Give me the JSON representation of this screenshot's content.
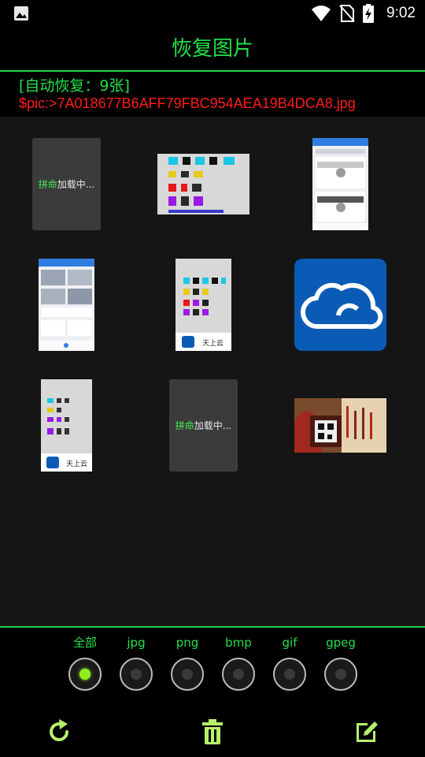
{
  "status_bar": {
    "time": "9:02",
    "icons": [
      "gallery-icon",
      "wifi-icon",
      "no-sim-icon",
      "battery-charging-icon"
    ]
  },
  "header": {
    "title": "恢复图片"
  },
  "info": {
    "recovered_label": "[自动恢复：9张]",
    "file_label": "$pic:>7A018677B6AFF79FBC954AEA19B4DCA8.jpg"
  },
  "grid": {
    "tiles": [
      {
        "kind": "loading",
        "loading_green": "拼命",
        "loading_white": "加载中..."
      },
      {
        "kind": "image",
        "desc": "colored-glyph-thumbnail"
      },
      {
        "kind": "image",
        "desc": "phone-screenshot-thumbnail"
      },
      {
        "kind": "image",
        "desc": "phone-screenshot-thumbnail"
      },
      {
        "kind": "image",
        "desc": "cloud-app-thumbnail",
        "caption": "天上云"
      },
      {
        "kind": "image",
        "desc": "cloud-logo",
        "color": "#0a5bb5"
      },
      {
        "kind": "image",
        "desc": "cloud-app-thumbnail",
        "caption": "天上云"
      },
      {
        "kind": "loading",
        "loading_green": "拼命",
        "loading_white": "加载中..."
      },
      {
        "kind": "image",
        "desc": "game-banner-thumbnail"
      }
    ]
  },
  "filters": {
    "options": [
      {
        "label": "全部",
        "selected": true
      },
      {
        "label": "jpg",
        "selected": false
      },
      {
        "label": "png",
        "selected": false
      },
      {
        "label": "bmp",
        "selected": false
      },
      {
        "label": "gif",
        "selected": false
      },
      {
        "label": "gpeg",
        "selected": false
      }
    ]
  },
  "toolbar": {
    "buttons": [
      "refresh-icon",
      "trash-icon",
      "edit-icon"
    ]
  },
  "colors": {
    "accent_green": "#22e04a",
    "error_red": "#ff1a1a",
    "background": "#000000",
    "grid_background": "#151515"
  }
}
